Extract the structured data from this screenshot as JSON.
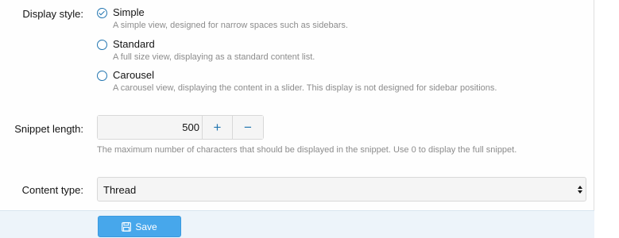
{
  "form": {
    "display_style": {
      "label": "Display style:",
      "options": [
        {
          "label": "Simple",
          "hint": "A simple view, designed for narrow spaces such as sidebars.",
          "checked": true
        },
        {
          "label": "Standard",
          "hint": "A full size view, displaying as a standard content list.",
          "checked": false
        },
        {
          "label": "Carousel",
          "hint": "A carousel view, displaying the content in a slider. This display is not designed for sidebar positions.",
          "checked": false
        }
      ]
    },
    "snippet_length": {
      "label": "Snippet length:",
      "value": "500",
      "plus": "+",
      "minus": "−",
      "hint": "The maximum number of characters that should be displayed in the snippet. Use 0 to display the full snippet."
    },
    "content_type": {
      "label": "Content type:",
      "selected": "Thread"
    },
    "save_label": "Save"
  },
  "colors": {
    "accent": "#2577b1",
    "button": "#47a7eb",
    "footer": "#edf4fa"
  },
  "icons": {
    "save": "save-icon",
    "select_arrows": "chevron-updown-icon"
  }
}
